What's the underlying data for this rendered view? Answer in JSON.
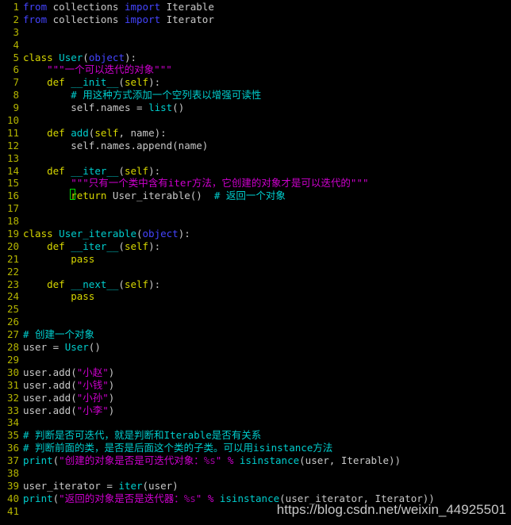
{
  "editor": {
    "language": "python",
    "background_color": "#000000",
    "theme": "terminal-dark",
    "cursor_color": "#00dd00",
    "gutter_color": "#b5b500",
    "default_text_color": "#c8c8c8",
    "cursor": {
      "line": 16,
      "column": 9,
      "char": "r"
    }
  },
  "watermark": {
    "text": "https://blog.csdn.net/weixin_44925501"
  },
  "lines": [
    {
      "number": "1",
      "text": "from collections import Iterable"
    },
    {
      "number": "2",
      "text": "from collections import Iterator"
    },
    {
      "number": "3",
      "text": ""
    },
    {
      "number": "4",
      "text": ""
    },
    {
      "number": "5",
      "text": "class User(object):"
    },
    {
      "number": "6",
      "text": "    \"\"\"一个可以迭代的对象\"\"\""
    },
    {
      "number": "7",
      "text": "    def __init__(self):"
    },
    {
      "number": "8",
      "text": "        # 用这种方式添加一个空列表以增强可读性"
    },
    {
      "number": "9",
      "text": "        self.names = list()"
    },
    {
      "number": "10",
      "text": ""
    },
    {
      "number": "11",
      "text": "    def add(self, name):"
    },
    {
      "number": "12",
      "text": "        self.names.append(name)"
    },
    {
      "number": "13",
      "text": ""
    },
    {
      "number": "14",
      "text": "    def __iter__(self):"
    },
    {
      "number": "15",
      "text": "        \"\"\"只有一个类中含有iter方法，它创建的对象才是可以迭代的\"\"\""
    },
    {
      "number": "16",
      "text": "        return User_iterable()  # 返回一个对象"
    },
    {
      "number": "17",
      "text": ""
    },
    {
      "number": "18",
      "text": ""
    },
    {
      "number": "19",
      "text": "class User_iterable(object):"
    },
    {
      "number": "20",
      "text": "    def __iter__(self):"
    },
    {
      "number": "21",
      "text": "        pass"
    },
    {
      "number": "22",
      "text": ""
    },
    {
      "number": "23",
      "text": "    def __next__(self):"
    },
    {
      "number": "24",
      "text": "        pass"
    },
    {
      "number": "25",
      "text": ""
    },
    {
      "number": "26",
      "text": ""
    },
    {
      "number": "27",
      "text": "# 创建一个对象"
    },
    {
      "number": "28",
      "text": "user = User()"
    },
    {
      "number": "29",
      "text": ""
    },
    {
      "number": "30",
      "text": "user.add(\"小赵\")"
    },
    {
      "number": "31",
      "text": "user.add(\"小钱\")"
    },
    {
      "number": "32",
      "text": "user.add(\"小孙\")"
    },
    {
      "number": "33",
      "text": "user.add(\"小李\")"
    },
    {
      "number": "34",
      "text": ""
    },
    {
      "number": "35",
      "text": "# 判断是否可迭代，就是判断和Iterable是否有关系"
    },
    {
      "number": "36",
      "text": "# 判断前面的类，是否是后面这个类的子类。可以用isinstance方法"
    },
    {
      "number": "37",
      "text": "print(\"创建的对象是否是可迭代对象：%s\" % isinstance(user, Iterable))"
    },
    {
      "number": "38",
      "text": ""
    },
    {
      "number": "39",
      "text": "user_iterator = iter(user)"
    },
    {
      "number": "40",
      "text": "print(\"返回的对象是否是迭代器：%s\" % isinstance(user_iterator, Iterator))"
    },
    {
      "number": "41",
      "text": ""
    }
  ],
  "tokens": {
    "l1": {
      "kw_from": "from",
      "mod": " collections ",
      "kw_import": "import",
      "cls": " Iterable"
    },
    "l2": {
      "kw_from": "from",
      "mod": " collections ",
      "kw_import": "import",
      "cls": " Iterator"
    },
    "l5": {
      "kw": "class",
      "name": " User",
      "p1": "(",
      "obj": "object",
      "p2": "):"
    },
    "l6": {
      "indent": "    ",
      "str": "\"\"\"一个可以迭代的对象\"\"\""
    },
    "l7": {
      "indent": "    ",
      "kw": "def",
      "name": " __init__",
      "p1": "(",
      "self": "self",
      "p2": "):"
    },
    "l8": {
      "indent": "        ",
      "cmt": "# 用这种方式添加一个空列表以增强可读性"
    },
    "l9": {
      "indent": "        ",
      "plain": "self.names = ",
      "name": "list",
      "p": "()"
    },
    "l11": {
      "indent": "    ",
      "kw": "def",
      "name": " add",
      "p1": "(",
      "self": "self",
      "args": ", name",
      "p2": "):"
    },
    "l12": {
      "indent": "        ",
      "plain": "self.names.append(name)"
    },
    "l14": {
      "indent": "    ",
      "kw": "def",
      "name": " __iter__",
      "p1": "(",
      "self": "self",
      "p2": "):"
    },
    "l15": {
      "indent": "        ",
      "str": "\"\"\"只有一个类中含有iter方法，它创建的对象才是可以迭代的\"\"\""
    },
    "l16": {
      "indent": "        ",
      "kw_first": "r",
      "kw_rest": "eturn",
      "plain": " User_iterable()  ",
      "cmt": "# 返回一个对象"
    },
    "l19": {
      "kw": "class",
      "name": " User_iterable",
      "p1": "(",
      "obj": "object",
      "p2": "):"
    },
    "l20": {
      "indent": "    ",
      "kw": "def",
      "name": " __iter__",
      "p1": "(",
      "self": "self",
      "p2": "):"
    },
    "l21": {
      "indent": "        ",
      "kw": "pass"
    },
    "l23": {
      "indent": "    ",
      "kw": "def",
      "name": " __next__",
      "p1": "(",
      "self": "self",
      "p2": "):"
    },
    "l24": {
      "indent": "        ",
      "kw": "pass"
    },
    "l27": {
      "cmt": "# 创建一个对象"
    },
    "l28": {
      "plain": "user = ",
      "name": "User",
      "p": "()"
    },
    "l30": {
      "plain": "user.add(",
      "str": "\"小赵\"",
      "p": ")"
    },
    "l31": {
      "plain": "user.add(",
      "str": "\"小钱\"",
      "p": ")"
    },
    "l32": {
      "plain": "user.add(",
      "str": "\"小孙\"",
      "p": ")"
    },
    "l33": {
      "plain": "user.add(",
      "str": "\"小李\"",
      "p": ")"
    },
    "l35": {
      "cmt": "# 判断是否可迭代，就是判断和Iterable是否有关系"
    },
    "l36": {
      "cmt": "# 判断前面的类，是否是后面这个类的子类。可以用isinstance方法"
    },
    "l37": {
      "name": "print",
      "p1": "(",
      "str": "\"创建的对象是否是可迭代对象：",
      "fmt": "%s",
      "strend": "\"",
      "op": " % ",
      "fn": "isinstance",
      "args": "(user, Iterable))"
    },
    "l39": {
      "plain": "user_iterator = ",
      "name": "iter",
      "args": "(user)"
    },
    "l40": {
      "name": "print",
      "p1": "(",
      "str": "\"返回的对象是否是迭代器：",
      "fmt": "%s",
      "strend": "\"",
      "op": " % ",
      "fn": "isinstance",
      "args": "(user_iterator, Iterator))"
    }
  }
}
